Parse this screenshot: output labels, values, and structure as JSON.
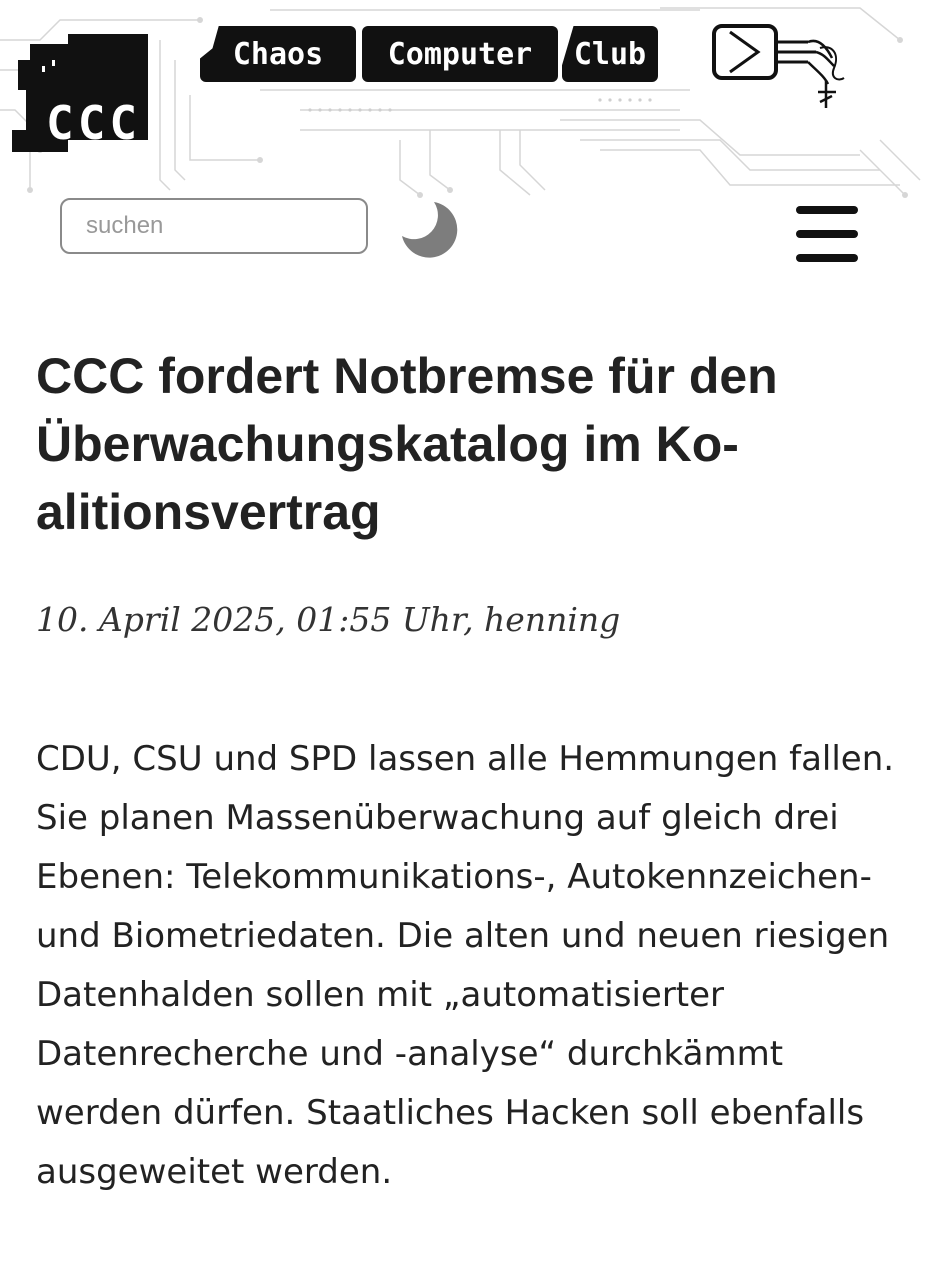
{
  "header": {
    "logo_text": "CCC",
    "banner": {
      "part1": "Chaos",
      "part2": "Computer",
      "part3": "Club"
    }
  },
  "search": {
    "placeholder": "suchen",
    "value": ""
  },
  "icons": {
    "theme_toggle": "moon-icon",
    "menu": "hamburger-menu-icon"
  },
  "article": {
    "title": "CCC fordert Notbremse für den Überwachungskatalog im Ko-alitionsvertrag",
    "meta": "10. April 2025, 01:55 Uhr, henning",
    "body": "CDU, CSU und SPD lassen alle Hemmungen fallen. Sie planen Massenüberwachung auf gleich drei Ebenen: Telekommunikations-, Autokennzeichen- und Biometriedaten. Die alten und neuen riesigen Datenhalden sollen mit „automatisierter Datenrecherche und -analyse“ durchkämmt werden dürfen. Staatliches Hacken soll ebenfalls ausgeweitet werden."
  }
}
